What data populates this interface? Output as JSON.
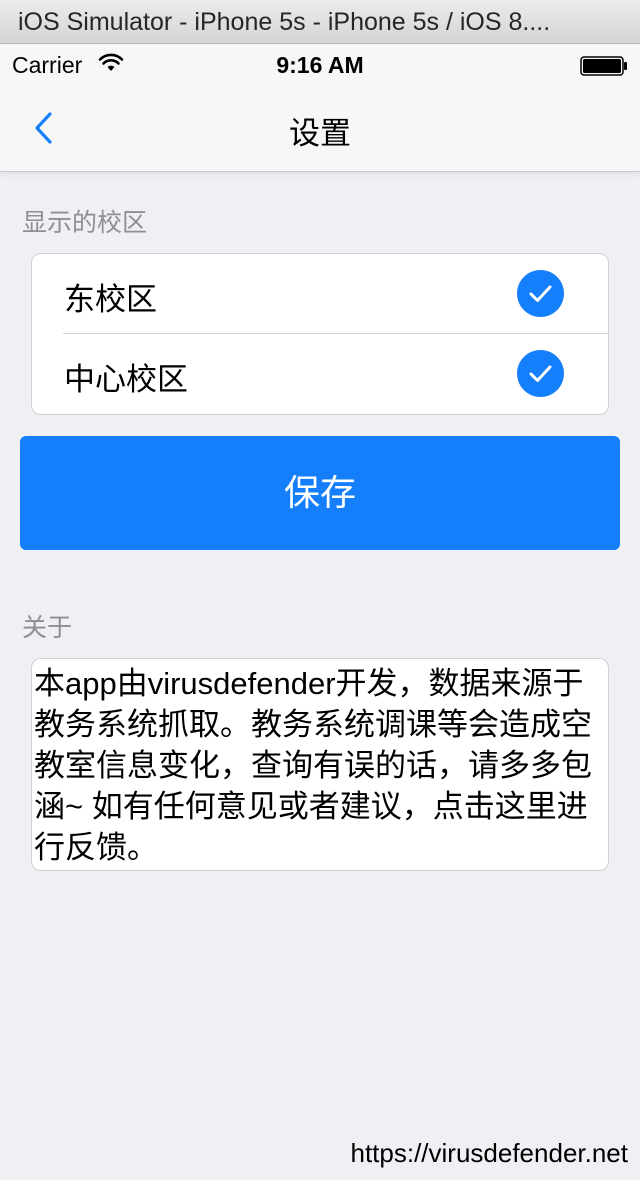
{
  "simulator": {
    "title": "iOS Simulator - iPhone 5s - iPhone 5s / iOS 8...."
  },
  "status_bar": {
    "carrier": "Carrier",
    "time": "9:16 AM",
    "icons": [
      "wifi-icon",
      "battery-icon"
    ]
  },
  "nav": {
    "title": "设置",
    "back_icon": "chevron-left-icon"
  },
  "campus_section": {
    "header": "显示的校区",
    "items": [
      {
        "label": "东校区",
        "checked": true
      },
      {
        "label": "中心校区",
        "checked": true
      }
    ]
  },
  "save_button": {
    "label": "保存"
  },
  "about_section": {
    "header": "关于",
    "text": "本app由virusdefender开发，数据来源于教务系统抓取。教务系统调课等会造成空教室信息变化，查询有误的话，请多多包涵~ 如有任何意见或者建议，点击这里进行反馈。"
  },
  "watermark": "https://virusdefender.net",
  "colors": {
    "accent": "#147efb",
    "background": "#efeff4",
    "section_label": "#8e8e93"
  }
}
